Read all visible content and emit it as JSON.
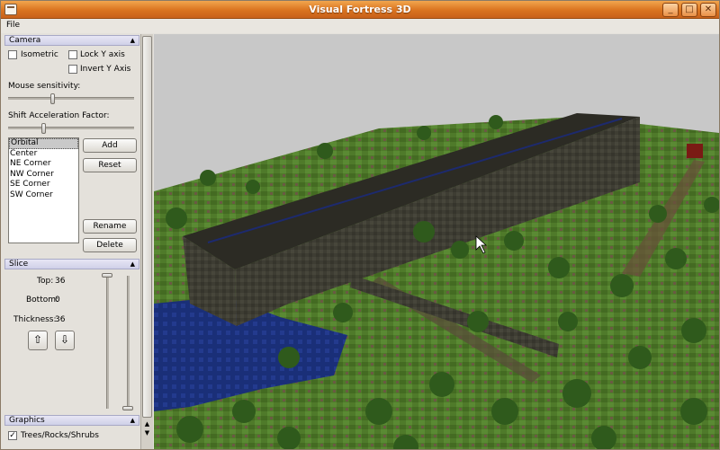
{
  "window": {
    "title": "Visual Fortress 3D"
  },
  "menubar": {
    "file_label": "File"
  },
  "camera": {
    "header": "Camera",
    "isometric_label": "Isometric",
    "isometric_checked": false,
    "lock_y_label": "Lock Y axis",
    "lock_y_checked": false,
    "invert_y_label": "Invert Y Axis",
    "invert_y_checked": false,
    "mouse_sensitivity_label": "Mouse sensitivity:",
    "mouse_sensitivity_value": 0.35,
    "shift_accel_label": "Shift Acceleration Factor:",
    "shift_accel_value": 0.28,
    "presets": [
      "Orbital",
      "Center",
      "NE Corner",
      "NW Corner",
      "SE Corner",
      "SW Corner"
    ],
    "selected_preset": "Orbital",
    "add_label": "Add",
    "reset_label": "Reset",
    "rename_label": "Rename",
    "delete_label": "Delete"
  },
  "slice": {
    "header": "Slice",
    "top_label": "Top:",
    "top_value": "36",
    "bottom_label": "Bottom:",
    "bottom_value": "0",
    "thickness_label": "Thickness:",
    "thickness_value": "36",
    "up_icon": "up-arrow-icon",
    "down_icon": "down-arrow-icon"
  },
  "graphics": {
    "header": "Graphics",
    "trees_label": "Trees/Rocks/Shrubs",
    "trees_checked": true
  },
  "colors": {
    "titlebar": "#d9731f",
    "sky": "#c8c8c8",
    "grass": "#4f7a2a",
    "wall": "#3e3d33",
    "water": "#1a2f78"
  }
}
